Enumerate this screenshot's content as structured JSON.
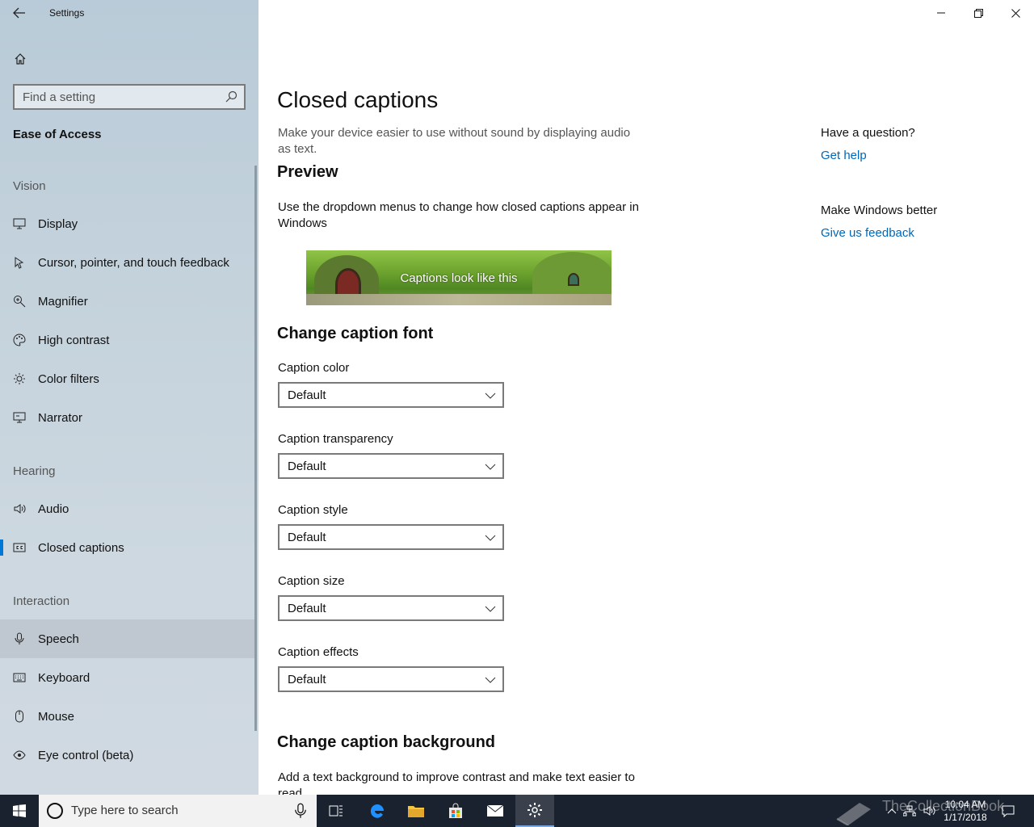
{
  "window": {
    "title": "Settings"
  },
  "sidebar": {
    "search_placeholder": "Find a setting",
    "section": "Ease of Access",
    "groups": {
      "vision": "Vision",
      "hearing": "Hearing",
      "interaction": "Interaction"
    },
    "items": [
      {
        "label": "Display",
        "icon": "monitor-icon"
      },
      {
        "label": "Cursor, pointer, and touch feedback",
        "icon": "cursor-icon"
      },
      {
        "label": "Magnifier",
        "icon": "magnifier-icon"
      },
      {
        "label": "High contrast",
        "icon": "palette-icon"
      },
      {
        "label": "Color filters",
        "icon": "sun-icon"
      },
      {
        "label": "Narrator",
        "icon": "narrator-icon"
      },
      {
        "label": "Audio",
        "icon": "speaker-icon"
      },
      {
        "label": "Closed captions",
        "icon": "cc-icon"
      },
      {
        "label": "Speech",
        "icon": "microphone-icon"
      },
      {
        "label": "Keyboard",
        "icon": "keyboard-icon"
      },
      {
        "label": "Mouse",
        "icon": "mouse-icon"
      },
      {
        "label": "Eye control (beta)",
        "icon": "eye-icon"
      }
    ],
    "selected": "Closed captions"
  },
  "main": {
    "title": "Closed captions",
    "intro": "Make your device easier to use without sound by displaying audio as text.",
    "preview_heading": "Preview",
    "preview_desc": "Use the dropdown menus to change how closed captions appear in Windows",
    "preview_caption": "Captions look like this",
    "font_heading": "Change caption font",
    "fields": [
      {
        "label": "Caption color",
        "value": "Default"
      },
      {
        "label": "Caption transparency",
        "value": "Default"
      },
      {
        "label": "Caption style",
        "value": "Default"
      },
      {
        "label": "Caption size",
        "value": "Default"
      },
      {
        "label": "Caption effects",
        "value": "Default"
      }
    ],
    "background_heading": "Change caption background",
    "background_desc": "Add a text background to improve contrast and make text easier to read"
  },
  "aside": {
    "question_heading": "Have a question?",
    "get_help": "Get help",
    "better_heading": "Make Windows better",
    "feedback": "Give us feedback"
  },
  "taskbar": {
    "search_text": "Type here to search",
    "time": "10:04 AM",
    "date": "1/17/2018",
    "watermark": "TheCollectionBook"
  },
  "colors": {
    "accent": "#0078d7",
    "link": "#0067b8",
    "taskbar": "#1a2230"
  }
}
